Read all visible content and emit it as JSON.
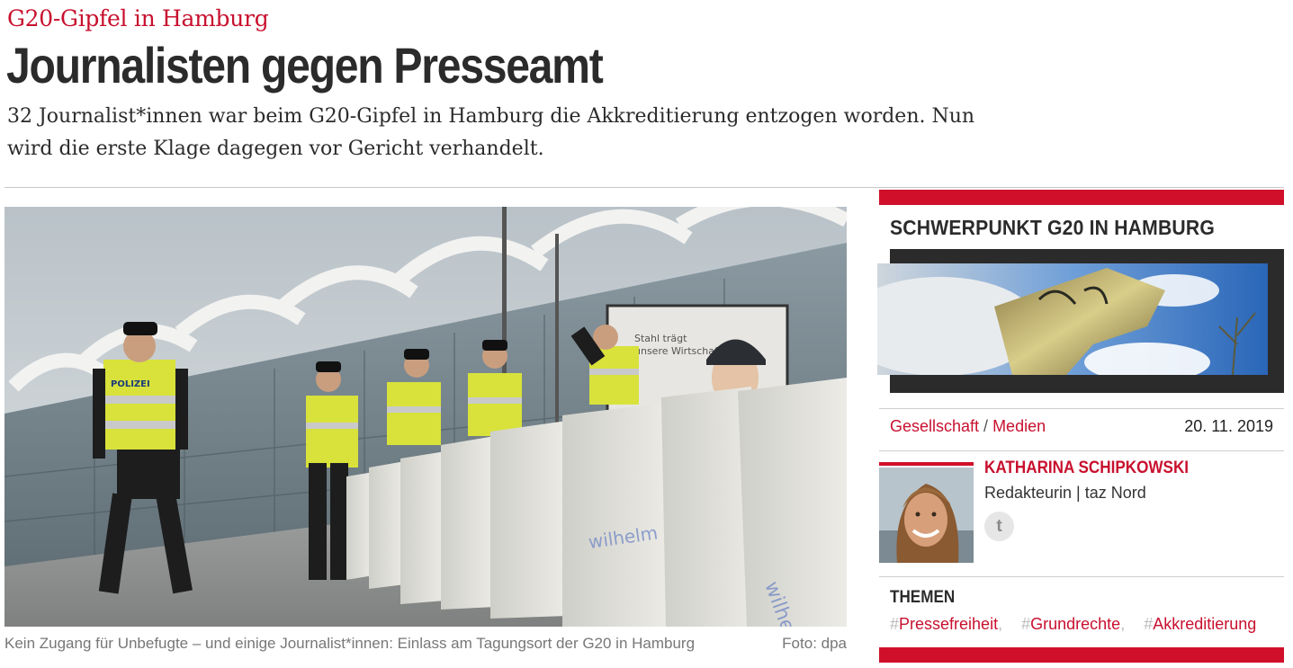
{
  "article": {
    "kicker": "G20-Gipfel in Hamburg",
    "headline": "Journalisten gegen Presseamt",
    "teaser": "32 Journalist*innen war beim G20-Gipfel in Hamburg die Akkreditierung entzogen worden. Nun wird die erste Klage dagegen vor Gericht verhandelt.",
    "image_caption": "Kein Zugang für Unbefugte – und einige Journalist*innen: Einlass am Tagungsort der G20 in Hamburg",
    "image_credit": "Foto: dpa",
    "image_sign_line1": "Stahl trägt",
    "image_sign_line2": "unsere Wirtschaft",
    "vest_text": "POLIZEI",
    "block_text": "wilhelm"
  },
  "sidebar": {
    "schwerpunkt_title": "SCHWERPUNKT G20 IN HAMBURG",
    "category_1": "Gesellschaft",
    "category_sep": "/",
    "category_2": "Medien",
    "date": "20. 11. 2019",
    "author_name": "KATHARINA SCHIPKOWSKI",
    "author_role": "Redakteurin | taz Nord",
    "twitter_glyph": "t",
    "themen_label": "THEMEN",
    "tags": [
      {
        "hash": "#",
        "label": "Pressefreiheit",
        "comma": ","
      },
      {
        "hash": "#",
        "label": "Grundrechte",
        "comma": ","
      },
      {
        "hash": "#",
        "label": "Akkreditierung",
        "comma": ""
      }
    ]
  },
  "colors": {
    "accent": "#c8102e",
    "bar": "#d0102a",
    "text": "#2b2b2b"
  }
}
